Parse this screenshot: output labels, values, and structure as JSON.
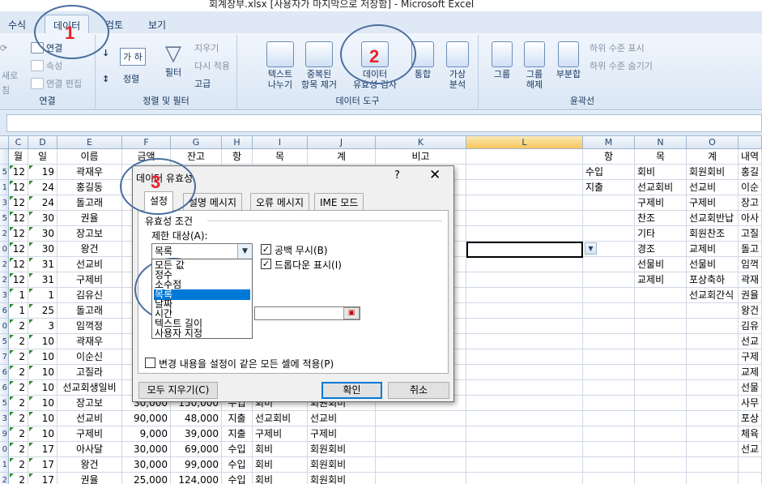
{
  "window": {
    "title": "회계장부.xlsx [사용자가 마지막으로 저장함] - Microsoft Excel"
  },
  "ribbon_tabs": [
    "수식",
    "데이터",
    "검토",
    "보기"
  ],
  "ribbon": {
    "connections": {
      "items": [
        "연결",
        "속성",
        "연결 편집"
      ],
      "refresh_label": "새로",
      "refresh_label2": "침",
      "label": "연결"
    },
    "sort_filter": {
      "az_label": "가 하",
      "sort_label": "정렬",
      "filter_label": "필터",
      "clear_label": "지우기",
      "reapply_label": "다시 적용",
      "advanced_label": "고급",
      "label": "정렬 및 필터"
    },
    "data_tools": {
      "text_to_columns": [
        "텍스트",
        "나누기"
      ],
      "remove_duplicates": [
        "중복된",
        "항목 제거"
      ],
      "validation": [
        "데이터",
        "유효성 검사"
      ],
      "consolidate": "통합",
      "what_if": [
        "가상",
        "분석"
      ],
      "label": "데이터 도구"
    },
    "outline": {
      "group": [
        "그룹"
      ],
      "ungroup": [
        "그룹",
        "해제"
      ],
      "subtotal": "부분합",
      "show_detail": "하위 수준 표시",
      "hide_detail": "하위 수준 숨기기",
      "label": "윤곽선"
    }
  },
  "grid": {
    "columns": [
      "C",
      "D",
      "E",
      "F",
      "G",
      "H",
      "I",
      "J",
      "K",
      "L",
      "M",
      "N",
      "O"
    ],
    "selected_column": "L",
    "header_row": {
      "c": "월",
      "d": "일",
      "e": "이름",
      "f": "금액",
      "g": "잔고",
      "h": "항",
      "i": "목",
      "j": "계",
      "k": "비고",
      "m": "항",
      "n": "목",
      "o": "계",
      "p": "내역"
    },
    "rows": [
      {
        "rh": "5",
        "c": "12",
        "d": "19",
        "e": "곽재우",
        "m": "수입",
        "n": "회비",
        "o": "회원회비",
        "p": "홍길"
      },
      {
        "rh": "1",
        "c": "12",
        "d": "24",
        "e": "홍길동",
        "m": "지출",
        "n": "선교회비",
        "o": "선교비",
        "p": "이순"
      },
      {
        "rh": "3",
        "c": "12",
        "d": "24",
        "e": "돌고래",
        "n": "구제비",
        "o": "구제비",
        "p": "장고"
      },
      {
        "rh": "5",
        "c": "12",
        "d": "30",
        "e": "권율",
        "n": "찬조",
        "o": "선교회반납",
        "p": "아사"
      },
      {
        "rh": "2",
        "c": "12",
        "d": "30",
        "e": "장고보",
        "n": "기타",
        "o": "회원찬조",
        "p": "고질"
      },
      {
        "rh": "0",
        "c": "12",
        "d": "30",
        "e": "왕건",
        "n": "경조",
        "o": "교제비",
        "p": "돌고"
      },
      {
        "rh": "2",
        "c": "12",
        "d": "31",
        "e": "선교비",
        "n": "선물비",
        "o": "선물비",
        "p": "임꺽"
      },
      {
        "rh": "2",
        "c": "12",
        "d": "31",
        "e": "구제비",
        "n": "교제비",
        "o": "포상축하",
        "p": "곽재"
      },
      {
        "rh": "3",
        "c": "1",
        "d": "1",
        "e": "김유신",
        "o": "선교회간식",
        "p": "권율"
      },
      {
        "rh": "6",
        "c": "1",
        "d": "25",
        "e": "돌고래",
        "p": "왕건"
      },
      {
        "rh": "0",
        "c": "2",
        "d": "3",
        "e": "임꺽정",
        "p": "김유"
      },
      {
        "rh": "5",
        "c": "2",
        "d": "10",
        "e": "곽재우",
        "p": "선교"
      },
      {
        "rh": "7",
        "c": "2",
        "d": "10",
        "e": "이순신",
        "p": "구제"
      },
      {
        "rh": "6",
        "c": "2",
        "d": "10",
        "e": "고질라",
        "p": "교제"
      },
      {
        "rh": "6",
        "c": "2",
        "d": "10",
        "e": "선교회생일비",
        "p": "선물"
      },
      {
        "rh": "5",
        "c": "2",
        "d": "10",
        "e": "장고보",
        "f": "30,000",
        "g": "150,000",
        "h": "수입",
        "i": "회비",
        "j": "회원회비",
        "p": "사무"
      },
      {
        "rh": "3",
        "c": "2",
        "d": "10",
        "e": "선교비",
        "f": "90,000",
        "g": "48,000",
        "h": "지출",
        "i": "선교회비",
        "j": "선교비",
        "p": "포상"
      },
      {
        "rh": "9",
        "c": "2",
        "d": "10",
        "e": "구제비",
        "f": "9,000",
        "g": "39,000",
        "h": "지출",
        "i": "구제비",
        "j": "구제비",
        "p": "체육"
      },
      {
        "rh": "0",
        "c": "2",
        "d": "17",
        "e": "아사달",
        "f": "30,000",
        "g": "69,000",
        "h": "수입",
        "i": "회비",
        "j": "회원회비",
        "p": "선교"
      },
      {
        "rh": "1",
        "c": "2",
        "d": "17",
        "e": "왕건",
        "f": "30,000",
        "g": "99,000",
        "h": "수입",
        "i": "회비",
        "j": "회원회비",
        "p": ""
      },
      {
        "rh": "2",
        "c": "2",
        "d": "17",
        "e": "권율",
        "f": "25,000",
        "g": "124,000",
        "h": "수입",
        "i": "회비",
        "j": "회원회비",
        "p": ""
      }
    ]
  },
  "dialog": {
    "title": "데이터 유효성",
    "help": "?",
    "close": "✕",
    "tabs": [
      "설정",
      "설명 메시지",
      "오류 메시지",
      "IME 모드"
    ],
    "group_label": "유효성 조건",
    "allow_label": "제한 대상(A):",
    "allow_value": "목록",
    "options": [
      "모든 값",
      "정수",
      "소수점",
      "목록",
      "날짜",
      "시간",
      "텍스트 길이",
      "사용자 지정"
    ],
    "highlighted_option": "목록",
    "ignore_blank": "공백 무시(B)",
    "in_cell_dropdown": "드롭다운 표시(I)",
    "apply_all": "변경 내용을 설정이 같은 모든 셀에 적용(P)",
    "clear_all": "모두 지우기(C)",
    "ok": "확인",
    "cancel": "취소"
  },
  "annotations": [
    "1",
    "2",
    "3",
    "4"
  ],
  "colors": {
    "annotation_number": "#e8222a",
    "annotation_circle": "#4a6f9f",
    "list_highlight": "#0078d7",
    "selected_col": "#f7c55c"
  }
}
